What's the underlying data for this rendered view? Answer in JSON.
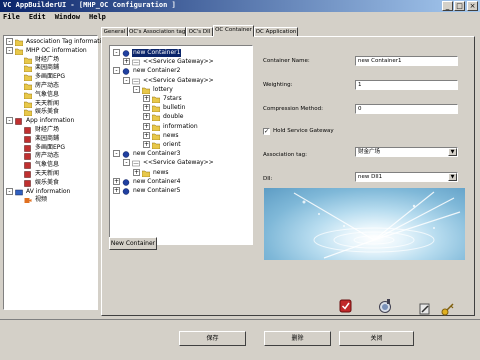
{
  "window": {
    "title": "VC AppBuilderUI - [MHP_OC Configuration ]",
    "controls": [
      "_",
      "□",
      "×"
    ]
  },
  "menu": [
    "File",
    "Edit",
    "Window",
    "Help"
  ],
  "left_tree": {
    "items": [
      {
        "label": "Association Tag information",
        "level": 0,
        "expander": "-",
        "icon": "folder-icon"
      },
      {
        "label": "MHP OC information",
        "level": 0,
        "expander": "-",
        "icon": "folder-icon"
      },
      {
        "label": "财经广场",
        "level": 1,
        "icon": "folder-icon"
      },
      {
        "label": "楽园商鋪",
        "level": 1,
        "icon": "folder-icon"
      },
      {
        "label": "多画面EPG",
        "level": 1,
        "icon": "folder-icon"
      },
      {
        "label": "房产动态",
        "level": 1,
        "icon": "folder-icon"
      },
      {
        "label": "气象信息",
        "level": 1,
        "icon": "folder-icon"
      },
      {
        "label": "天天新闻",
        "level": 1,
        "icon": "folder-icon"
      },
      {
        "label": "娱乐美食",
        "level": 1,
        "icon": "folder-icon"
      },
      {
        "label": "App information",
        "level": 0,
        "expander": "-",
        "icon": "app-icon"
      },
      {
        "label": "财经广场",
        "level": 1,
        "icon": "app-icon"
      },
      {
        "label": "楽园商鋪",
        "level": 1,
        "icon": "app-icon"
      },
      {
        "label": "多画面EPG",
        "level": 1,
        "icon": "app-icon"
      },
      {
        "label": "房产动态",
        "level": 1,
        "icon": "app-icon"
      },
      {
        "label": "气象信息",
        "level": 1,
        "icon": "app-icon"
      },
      {
        "label": "天天新闻",
        "level": 1,
        "icon": "app-icon"
      },
      {
        "label": "娱乐美食",
        "level": 1,
        "icon": "app-icon"
      },
      {
        "label": "AV information",
        "level": 0,
        "expander": "-",
        "icon": "av-icon"
      },
      {
        "label": "视频",
        "level": 1,
        "icon": "video-icon"
      }
    ]
  },
  "tabs": [
    {
      "label": "General",
      "active": false
    },
    {
      "label": "OC's Association tag",
      "active": false
    },
    {
      "label": "OC's DII",
      "active": false
    },
    {
      "label": "OC Container",
      "active": true
    },
    {
      "label": "OC Application",
      "active": false
    }
  ],
  "container_tree": {
    "items": [
      {
        "label": "new Container1",
        "level": 0,
        "expander": "-",
        "selected": true,
        "icon": "container-icon"
      },
      {
        "label": "<<Service Gateway>>",
        "level": 1,
        "expander": "+",
        "icon": "gateway-icon"
      },
      {
        "label": "new Container2",
        "level": 0,
        "expander": "-",
        "icon": "container-icon"
      },
      {
        "label": "<<Service Gateway>>",
        "level": 1,
        "expander": "-",
        "icon": "gateway-icon"
      },
      {
        "label": "lottery",
        "level": 2,
        "expander": "-",
        "icon": "folder-icon"
      },
      {
        "label": "7stars",
        "level": 3,
        "expander": "+",
        "icon": "folder-icon"
      },
      {
        "label": "bulletin",
        "level": 3,
        "expander": "+",
        "icon": "folder-icon"
      },
      {
        "label": "double",
        "level": 3,
        "expander": "+",
        "icon": "folder-icon"
      },
      {
        "label": "information",
        "level": 3,
        "expander": "+",
        "icon": "folder-icon"
      },
      {
        "label": "news",
        "level": 3,
        "expander": "+",
        "icon": "folder-icon"
      },
      {
        "label": "orient",
        "level": 3,
        "expander": "+",
        "icon": "folder-icon"
      },
      {
        "label": "new Container3",
        "level": 0,
        "expander": "-",
        "icon": "container-icon"
      },
      {
        "label": "<<Service Gateway>>",
        "level": 1,
        "expander": "-",
        "icon": "gateway-icon"
      },
      {
        "label": "news",
        "level": 2,
        "expander": "+",
        "icon": "folder-icon"
      },
      {
        "label": "new Container4",
        "level": 0,
        "expander": "+",
        "icon": "container-icon"
      },
      {
        "label": "new Container5",
        "level": 0,
        "expander": "+",
        "icon": "container-icon"
      }
    ]
  },
  "form": {
    "container_name_label": "Container Name:",
    "container_name_value": "new Container1",
    "weighting_label": "Weighting:",
    "weighting_value": "1",
    "compression_label": "Compression Method:",
    "compression_value": "0",
    "hold_gateway_label": "Hold Service Gateway",
    "hold_gateway_checked": "✓",
    "association_label": "Association tag:",
    "association_value": "财金广场",
    "dii_label": "DII:",
    "dii_value": "new DII1"
  },
  "new_container_button": "New Container",
  "toolbar_icons": [
    "apply-icon",
    "inspect-icon",
    "edit-icon",
    "key-icon"
  ],
  "bottom_buttons": {
    "save": "保存",
    "delete": "删除",
    "close": "关闭"
  },
  "colors": {
    "selection": "#0a246a",
    "face": "#d4d0c8",
    "title_start": "#0a246a",
    "title_end": "#a6caf0"
  }
}
